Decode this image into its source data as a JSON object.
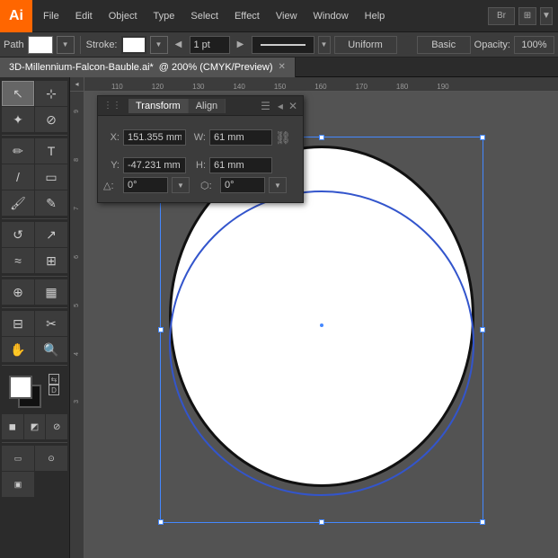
{
  "app": {
    "logo": "Ai",
    "title": "Adobe Illustrator"
  },
  "menubar": {
    "items": [
      "File",
      "Edit",
      "Object",
      "Type",
      "Select",
      "Effect",
      "View",
      "Window",
      "Help"
    ]
  },
  "controlbar": {
    "label": "Path",
    "stroke_label": "Stroke:",
    "stroke_width": "1 pt",
    "stroke_type": "Uniform",
    "opacity_label": "Opacity:",
    "opacity_value": "100%",
    "blend_mode": "Basic"
  },
  "tab": {
    "title": "3D-Millennium-Falcon-Bauble.ai*",
    "subtitle": "@ 200% (CMYK/Preview)"
  },
  "tools": {
    "items": [
      "↖",
      "⊹",
      "✏",
      "⊟",
      "T",
      "⊞",
      "⬡",
      "✂",
      "↺",
      "◎",
      "≈",
      "⊘",
      "✦",
      "⊕",
      "↗",
      "⌂",
      "✋",
      "🔍",
      "▣",
      "◻",
      "●"
    ]
  },
  "transform_panel": {
    "title": "Transform",
    "tab1": "Transform",
    "tab2": "Align",
    "x_label": "X:",
    "x_value": "151.355 mm",
    "w_label": "W:",
    "w_value": "61 mm",
    "y_label": "Y:",
    "y_value": "-47.231 mm",
    "h_label": "H:",
    "h_value": "61 mm",
    "angle1_label": "△:",
    "angle1_value": "0°",
    "angle2_label": "⬡:",
    "angle2_value": "0°"
  },
  "ruler": {
    "h_ticks": [
      "110",
      "120",
      "130",
      "140",
      "150",
      "160",
      "170",
      "180",
      "190"
    ],
    "v_ticks": [
      "9",
      "8",
      "7",
      "6",
      "5",
      "4",
      "3"
    ]
  }
}
